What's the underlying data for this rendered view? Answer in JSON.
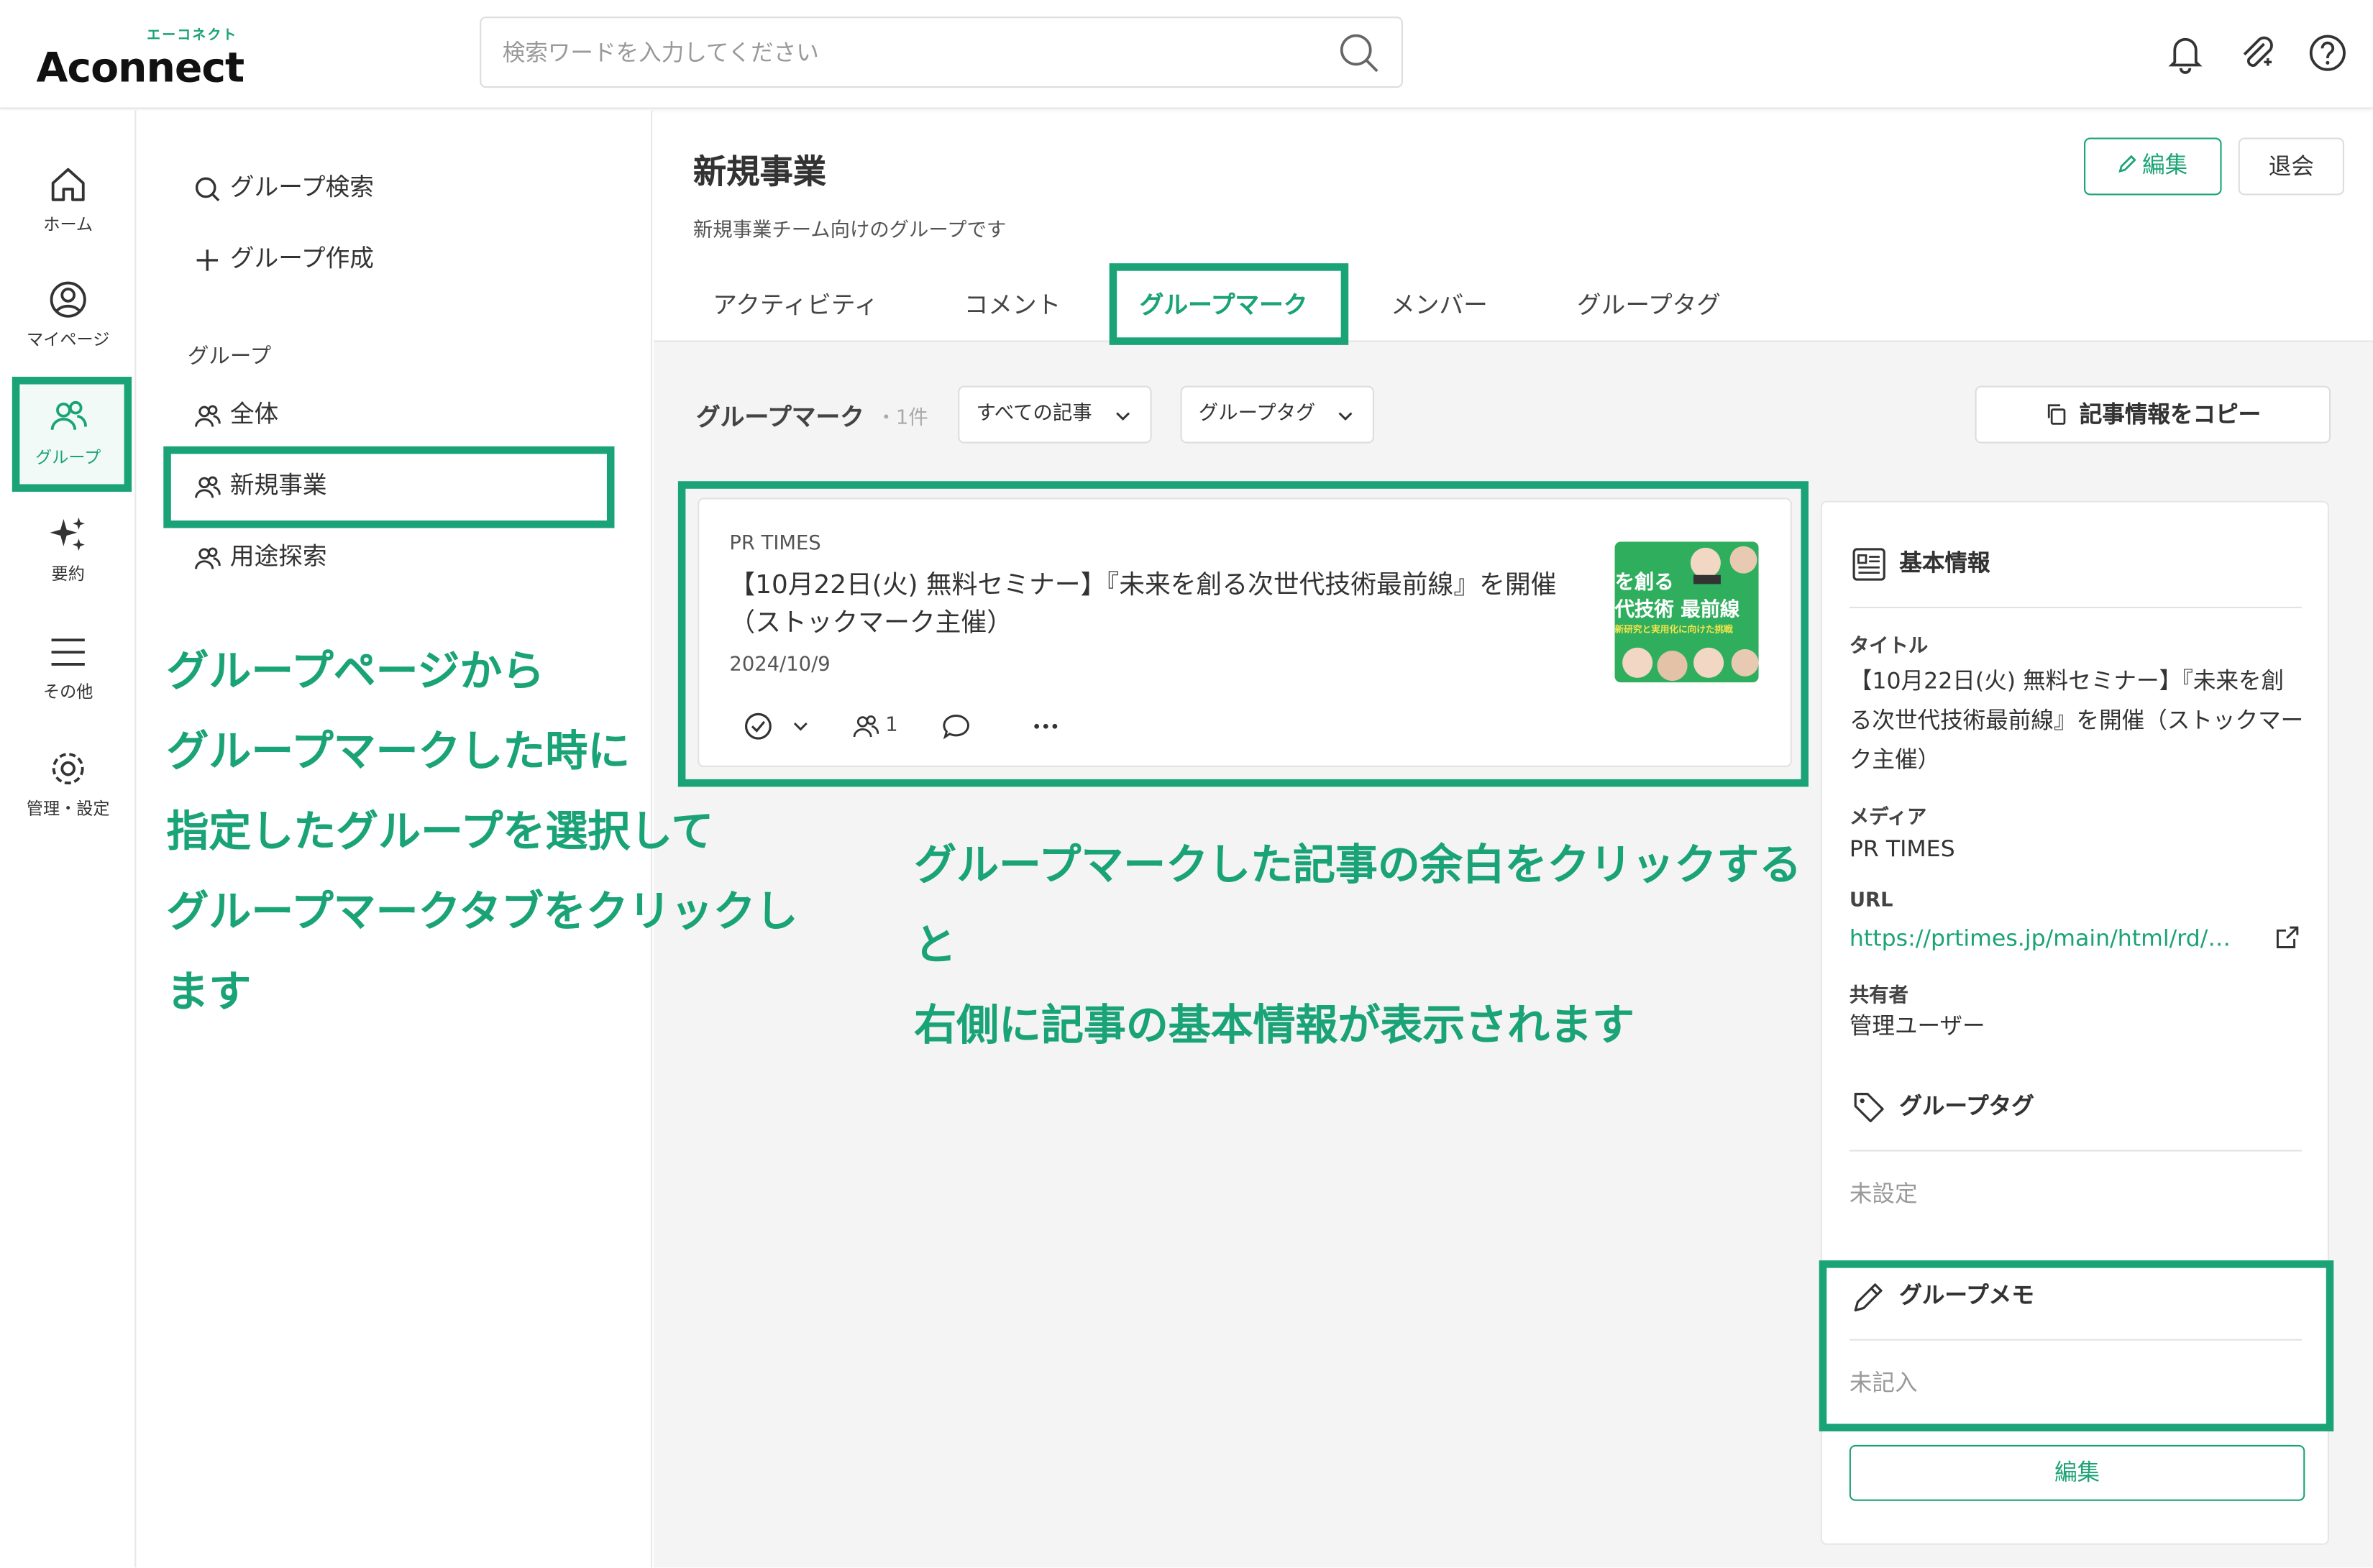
{
  "app": {
    "logo_kana": "エーコネクト",
    "logo_word": "Aconnect"
  },
  "search": {
    "placeholder": "検索ワードを入力してください"
  },
  "rail": [
    {
      "label": "ホーム",
      "icon": "home-icon"
    },
    {
      "label": "マイページ",
      "icon": "user-circle-icon"
    },
    {
      "label": "グループ",
      "icon": "group-icon"
    },
    {
      "label": "要約",
      "icon": "sparkle-icon"
    },
    {
      "label": "その他",
      "icon": "menu-icon"
    },
    {
      "label": "管理・設定",
      "icon": "gear-icon"
    }
  ],
  "subnav": {
    "search_label": "グループ検索",
    "create_label": "グループ作成",
    "section_label": "グループ",
    "groups": [
      "全体",
      "新規事業",
      "用途探索"
    ]
  },
  "group": {
    "title": "新規事業",
    "description": "新規事業チーム向けのグループです",
    "edit_label": "編集",
    "leave_label": "退会"
  },
  "tabs": [
    "アクティビティ",
    "コメント",
    "グループマーク",
    "メンバー",
    "グループタグ"
  ],
  "toolbar": {
    "label": "グループマーク",
    "count": "・1件",
    "filter_articles": "すべての記事",
    "filter_tags": "グループタグ",
    "copy_label": "記事情報をコピー"
  },
  "article": {
    "source": "PR TIMES",
    "title": "【10月22日(火) 無料セミナー】『未来を創る次世代技術最前線』を開催（ストックマーク主催）",
    "date": "2024/10/9",
    "member_count": "1",
    "thumb_line1": "を創る",
    "thumb_line2": "代技術 最前線",
    "thumb_line3": "新研究と実用化に向けた挑戦"
  },
  "panel": {
    "basic_heading": "基本情報",
    "title_label": "タイトル",
    "title_value": "【10月22日(火) 無料セミナー】『未来を創る次世代技術最前線』を開催（ストックマーク主催）",
    "media_label": "メディア",
    "media_value": "PR TIMES",
    "url_label": "URL",
    "url_value": "https://prtimes.jp/main/html/rd/…",
    "sharer_label": "共有者",
    "sharer_value": "管理ユーザー",
    "tag_heading": "グループタグ",
    "tag_value": "未設定",
    "memo_heading": "グループメモ",
    "memo_value": "未記入",
    "memo_edit_label": "編集"
  },
  "annotations": {
    "left": [
      "グループページから",
      "グループマークした時に",
      "指定したグループを選択して",
      "グループマークタブをクリックします"
    ],
    "right": [
      "グループマークした記事の余白をクリックすると",
      "右側に記事の基本情報が表示されます"
    ]
  },
  "colors": {
    "accent": "#1aa376",
    "background": "#f4f4f4"
  }
}
